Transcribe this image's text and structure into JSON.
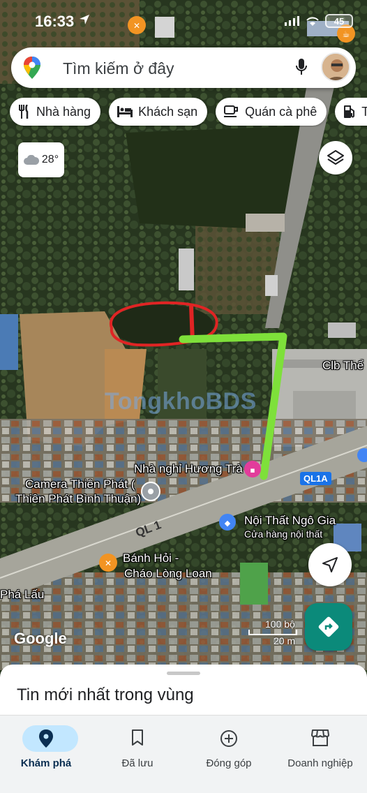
{
  "status_bar": {
    "time": "16:33",
    "battery": "45"
  },
  "search": {
    "placeholder": "Tìm kiếm ở đây"
  },
  "chips": [
    {
      "label": "Nhà hàng",
      "icon": "restaurant-icon"
    },
    {
      "label": "Khách sạn",
      "icon": "hotel-icon"
    },
    {
      "label": "Quán cà phê",
      "icon": "cafe-icon"
    },
    {
      "label": "Tr",
      "icon": "gas-station-icon"
    }
  ],
  "weather": {
    "temp": "28°",
    "icon": "cloud-icon"
  },
  "map_labels": {
    "clb": "Clb Thể",
    "nha_nghi": "Nhà nghỉ Hương Trà",
    "camera_line1": "Camera Thiên Phát (",
    "camera_line2": "Thiên Phát Bình Thuận)",
    "noi_that": "Nội Thất Ngô Gia",
    "noi_that_sub": "Cửa hàng nội thất",
    "banh_hoi_line1": "Bánh Hỏi -",
    "banh_hoi_line2": "Cháo Lòng Loan",
    "pha_lau": "Phá Lấu",
    "road_ql1": "QL 1",
    "road_ql1a": "QL1A"
  },
  "watermark": "TongkhoBDS",
  "google_logo": "Google",
  "scale": {
    "top": "100 bộ",
    "bottom": "20 m"
  },
  "sheet": {
    "title": "Tin mới nhất trong vùng"
  },
  "nav": [
    {
      "label": "Khám phá",
      "icon": "explore-pin-icon",
      "active": true
    },
    {
      "label": "Đã lưu",
      "icon": "bookmark-icon",
      "active": false
    },
    {
      "label": "Đóng góp",
      "icon": "add-circle-icon",
      "active": false
    },
    {
      "label": "Doanh nghiệp",
      "icon": "storefront-icon",
      "active": false
    }
  ],
  "colors": {
    "annotation_red": "#e02424",
    "annotation_green": "#7ee03a",
    "accent_blue": "#1a73e8",
    "nav_active": "#c2e7ff",
    "directions": "#0b8a7a"
  }
}
